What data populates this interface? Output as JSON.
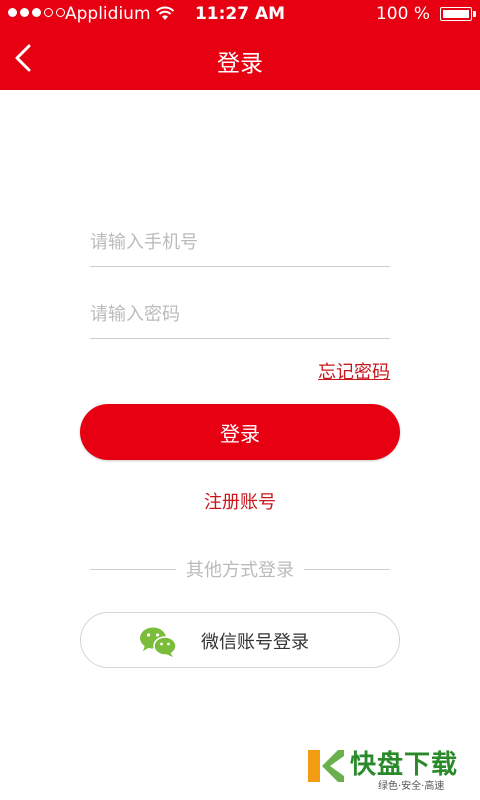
{
  "status_bar": {
    "carrier": "Applidium",
    "time": "11:27 AM",
    "battery": "100 %"
  },
  "nav": {
    "title": "登录"
  },
  "form": {
    "phone_placeholder": "请输入手机号",
    "password_placeholder": "请输入密码",
    "forgot_label": "忘记密码",
    "login_label": "登录",
    "register_label": "注册账号"
  },
  "other": {
    "divider_label": "其他方式登录",
    "wechat_label": "微信账号登录"
  },
  "colors": {
    "primary": "#e60012",
    "link": "#c8161d",
    "wechat_green": "#7bbd3a"
  },
  "watermark": {
    "brand": "快盘下载",
    "tagline": "绿色·安全·高速"
  }
}
